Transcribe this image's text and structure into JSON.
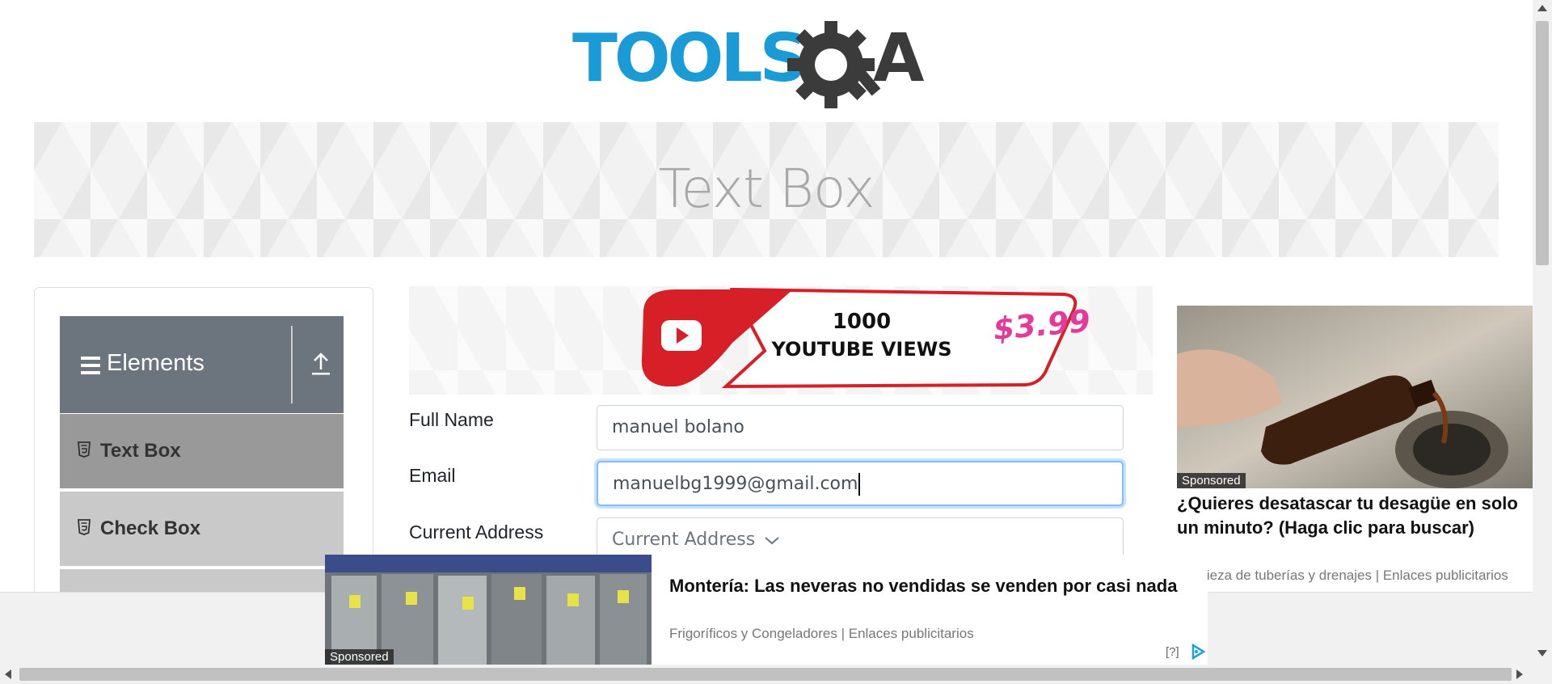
{
  "logo": {
    "text_left": "TOOLS",
    "text_right": "A",
    "colors": {
      "tools": "#1a9bd6",
      "qa": "#3b3b3b"
    }
  },
  "banner": {
    "title": "Text Box"
  },
  "sidebar": {
    "header": "Elements",
    "items": [
      {
        "label": "Text Box",
        "icon": "html5-icon"
      },
      {
        "label": "Check Box",
        "icon": "html5-icon"
      }
    ]
  },
  "top_ad": {
    "line1": "1000",
    "line2": "YOUTUBE VIEWS",
    "price": "$3.99"
  },
  "form": {
    "full_name": {
      "label": "Full Name",
      "value": "manuel bolano"
    },
    "email": {
      "label": "Email",
      "value": "manuelbg1999@gmail.com"
    },
    "current_address": {
      "label": "Current Address",
      "placeholder": "Current Address"
    }
  },
  "right_ad": {
    "sponsored": "Sponsored",
    "title": "¿Quieres desatascar tu desagüe en solo un minuto? (Haga clic para buscar)",
    "source": "Limpieza de tuberías y drenajes | Enlaces publicitarios"
  },
  "bottom_ad": {
    "sponsored": "Sponsored",
    "title": "Montería: Las neveras no vendidas se venden por casi nada",
    "source": "Frigoríficos y Congeladores | Enlaces publicitarios",
    "info": "[?]"
  }
}
